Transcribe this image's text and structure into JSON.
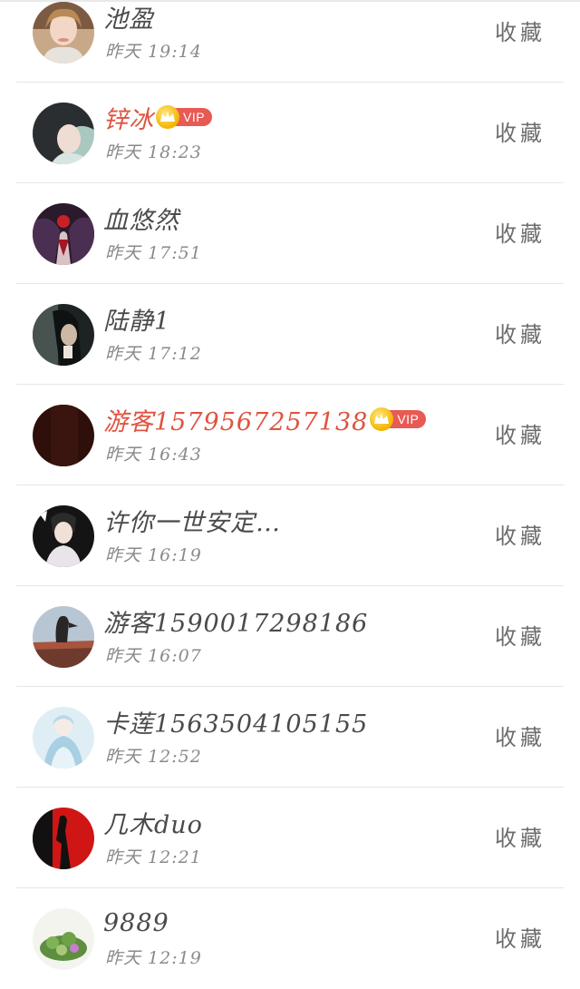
{
  "favorite_label": "收藏",
  "vip_label": "VIP",
  "colors": {
    "vip_name": "#e0533f",
    "name": "#4a4a4a",
    "time": "#8a8a8a",
    "vip_tag": "#e85a54",
    "crown": "#f4b400"
  },
  "users": [
    {
      "name": "池盈",
      "time": "昨天 19:14",
      "vip": false,
      "avatar": "avatar-blonde-woman"
    },
    {
      "name": "锌冰",
      "time": "昨天 18:23",
      "vip": true,
      "avatar": "avatar-dark-hair-girl"
    },
    {
      "name": "血悠然",
      "time": "昨天 17:51",
      "vip": false,
      "avatar": "avatar-red-dress-figure"
    },
    {
      "name": "陆静1",
      "time": "昨天 17:12",
      "vip": false,
      "avatar": "avatar-woman-dark-background"
    },
    {
      "name": "游客1579567257138",
      "time": "昨天 16:43",
      "vip": true,
      "avatar": "avatar-dark-brown"
    },
    {
      "name": "许你一世安定…",
      "time": "昨天 16:19",
      "vip": false,
      "avatar": "avatar-costume-drama"
    },
    {
      "name": "游客1590017298186",
      "time": "昨天 16:07",
      "vip": false,
      "avatar": "avatar-rooftop-silhouette"
    },
    {
      "name": "卡莲1563504105155",
      "time": "昨天 12:52",
      "vip": false,
      "avatar": "avatar-anime-princess"
    },
    {
      "name": "几木duo",
      "time": "昨天 12:21",
      "vip": false,
      "avatar": "avatar-red-silhouette"
    },
    {
      "name": "9889",
      "time": "昨天 12:19",
      "vip": false,
      "avatar": "avatar-succulent-plant"
    }
  ]
}
